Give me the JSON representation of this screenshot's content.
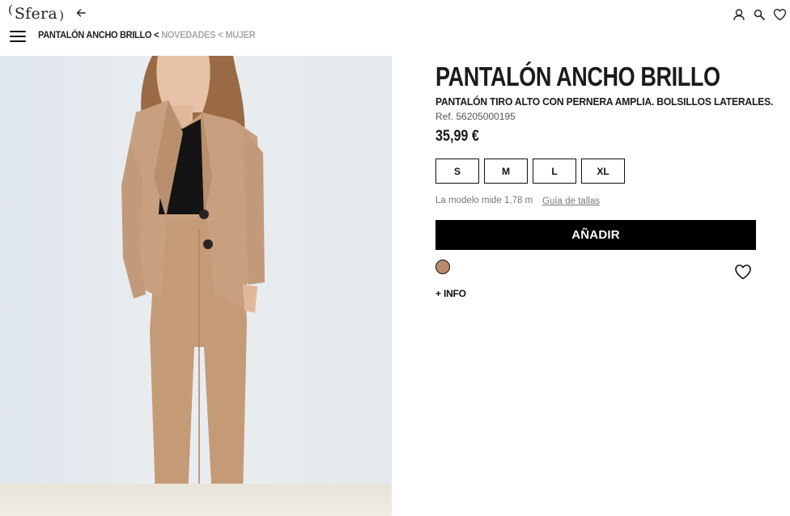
{
  "header": {
    "logo_text": "Sfera",
    "logo_paren_left": "(",
    "logo_paren_right": ")",
    "icons": [
      "back-arrow-icon",
      "user-icon",
      "search-icon",
      "heart-icon",
      "menu-icon"
    ]
  },
  "breadcrumb": {
    "current": "PANTALÓN ANCHO BRILLO",
    "separator": "<",
    "items": [
      "NOVEDADES",
      "MUJER"
    ]
  },
  "product": {
    "title": "PANTALÓN ANCHO BRILLO",
    "subtitle": "PANTALÓN TIRO ALTO CON PERNERA AMPLIA. BOLSILLOS LATERALES.",
    "ref": "Ref. 56205000195",
    "price": "35,99 €",
    "sizes": [
      "S",
      "M",
      "L",
      "XL"
    ],
    "model_info": "La modelo mide 1,78 m",
    "size_guide_label": "Guía de tallas",
    "add_button_label": "AÑADIR",
    "color_swatch": "#b98b6c",
    "more_info_label": "+ INFO"
  },
  "colors": {
    "accent": "#000000",
    "breadcrumb_inactive": "#a9a9a9"
  }
}
